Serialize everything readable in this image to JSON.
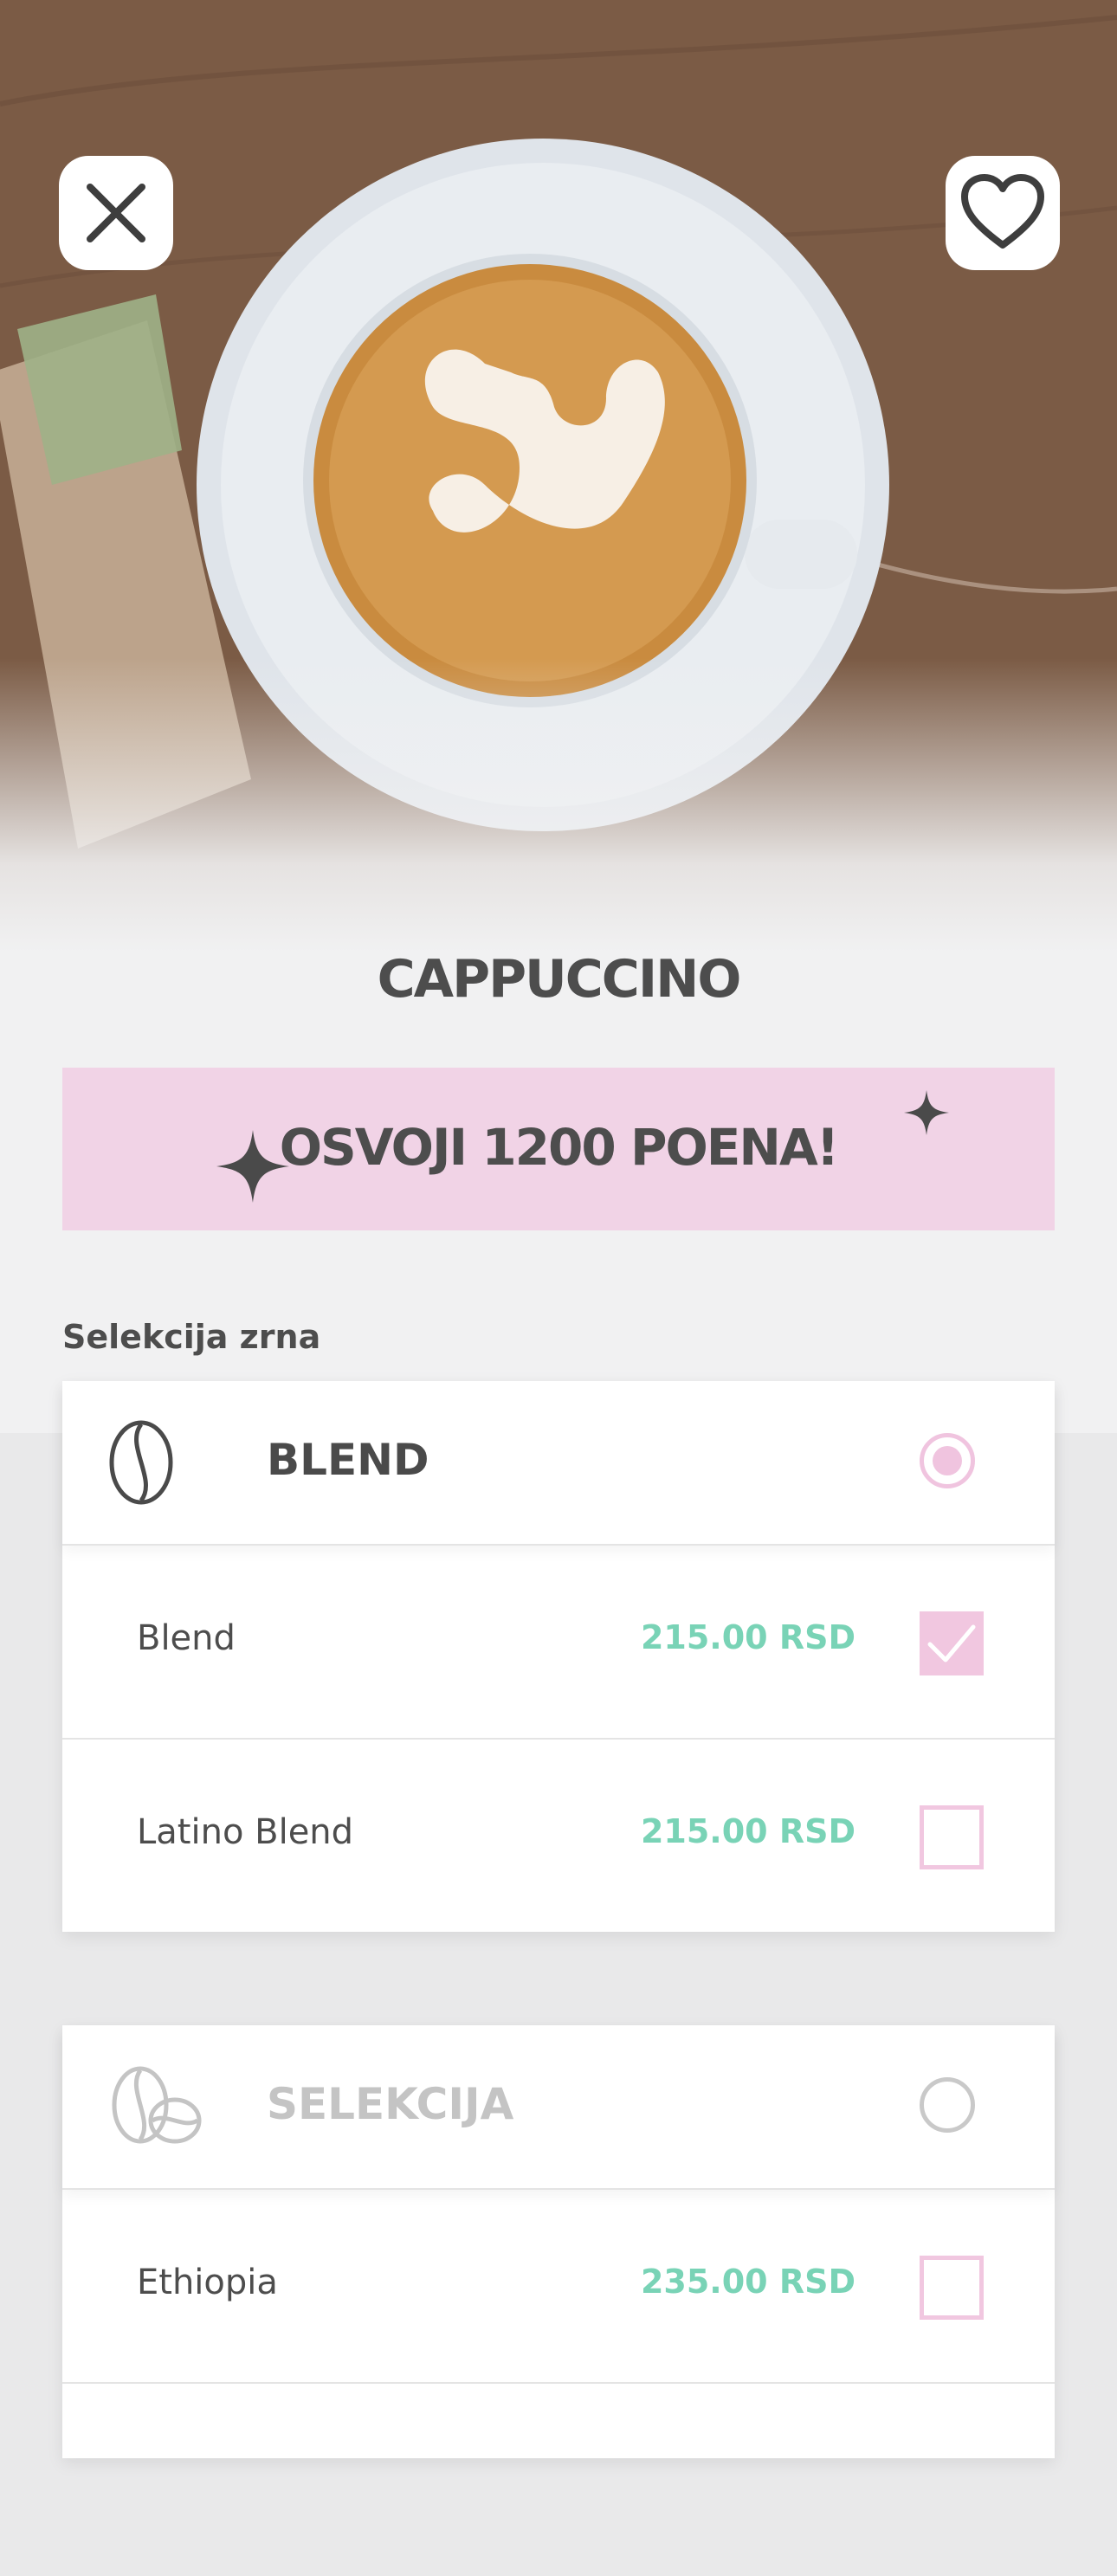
{
  "header": {
    "close_icon": "close-icon",
    "favorite_icon": "heart-icon"
  },
  "product": {
    "title": "CAPPUCCINO"
  },
  "promo": {
    "text": "OSVOJI 1200 POENA!",
    "background": "#f1d3e6"
  },
  "bean_selection": {
    "label": "Selekcija zrna",
    "groups": [
      {
        "title": "BLEND",
        "icon": "coffee-bean-icon",
        "selected": true,
        "items": [
          {
            "name": "Blend",
            "price": "215.00 RSD",
            "checked": true
          },
          {
            "name": "Latino Blend",
            "price": "215.00 RSD",
            "checked": false
          }
        ]
      },
      {
        "title": "SELEKCIJA",
        "icon": "coffee-beans-icon",
        "selected": false,
        "items": [
          {
            "name": "Ethiopia",
            "price": "235.00 RSD",
            "checked": false
          }
        ]
      }
    ]
  },
  "colors": {
    "price": "#79d3b6",
    "accent_pink": "#f0c4df",
    "text": "#4d4d4d"
  }
}
